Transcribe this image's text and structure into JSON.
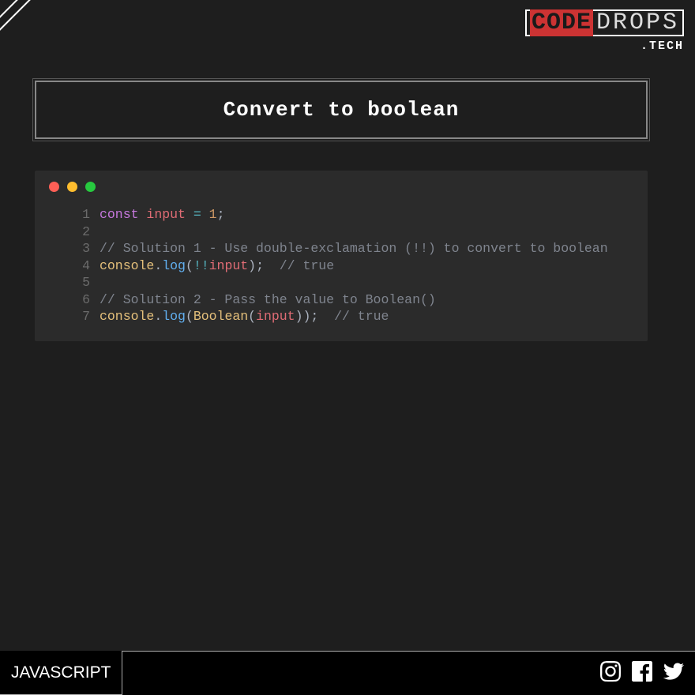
{
  "brand": {
    "code": "CODE",
    "drops": "DROPS",
    "sub": ".TECH"
  },
  "title": "Convert to boolean",
  "code": {
    "lines": [
      {
        "n": "1",
        "tokens": [
          {
            "cls": "tk-keyword",
            "t": "const"
          },
          {
            "cls": "tk-punc",
            "t": " "
          },
          {
            "cls": "tk-ident",
            "t": "input"
          },
          {
            "cls": "tk-punc",
            "t": " "
          },
          {
            "cls": "tk-op",
            "t": "="
          },
          {
            "cls": "tk-punc",
            "t": " "
          },
          {
            "cls": "tk-num",
            "t": "1"
          },
          {
            "cls": "tk-punc",
            "t": ";"
          }
        ]
      },
      {
        "n": "2",
        "tokens": []
      },
      {
        "n": "3",
        "tokens": [
          {
            "cls": "tk-comment",
            "t": "// Solution 1 - Use double-exclamation (!!) to convert to boolean"
          }
        ]
      },
      {
        "n": "4",
        "tokens": [
          {
            "cls": "tk-obj",
            "t": "console"
          },
          {
            "cls": "tk-punc",
            "t": "."
          },
          {
            "cls": "tk-method",
            "t": "log"
          },
          {
            "cls": "tk-punc",
            "t": "("
          },
          {
            "cls": "tk-op",
            "t": "!!"
          },
          {
            "cls": "tk-ident",
            "t": "input"
          },
          {
            "cls": "tk-punc",
            "t": ");  "
          },
          {
            "cls": "tk-comment",
            "t": "// true"
          }
        ]
      },
      {
        "n": "5",
        "tokens": []
      },
      {
        "n": "6",
        "tokens": [
          {
            "cls": "tk-comment",
            "t": "// Solution 2 - Pass the value to Boolean()"
          }
        ]
      },
      {
        "n": "7",
        "tokens": [
          {
            "cls": "tk-obj",
            "t": "console"
          },
          {
            "cls": "tk-punc",
            "t": "."
          },
          {
            "cls": "tk-method",
            "t": "log"
          },
          {
            "cls": "tk-punc",
            "t": "("
          },
          {
            "cls": "tk-obj",
            "t": "Boolean"
          },
          {
            "cls": "tk-punc",
            "t": "("
          },
          {
            "cls": "tk-ident",
            "t": "input"
          },
          {
            "cls": "tk-punc",
            "t": "));  "
          },
          {
            "cls": "tk-comment",
            "t": "// true"
          }
        ]
      }
    ]
  },
  "footer": {
    "tag": "JAVASCRIPT"
  }
}
